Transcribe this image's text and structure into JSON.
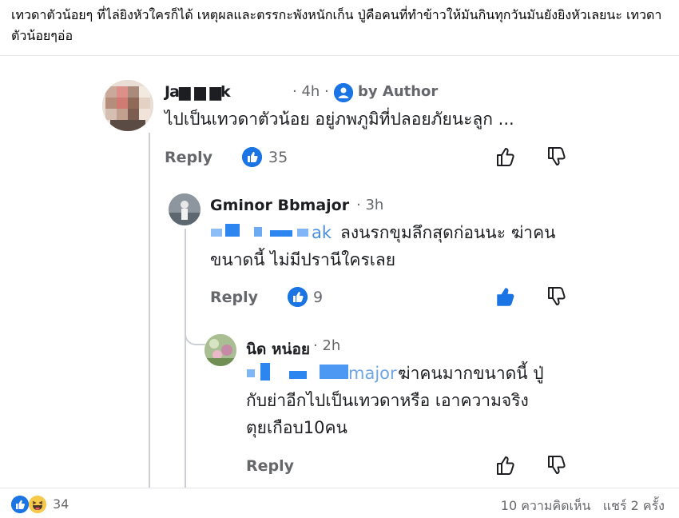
{
  "post": {
    "text": "เทวดาตัวน้อยๆ ที่ไล่ยิงหัวใครก็ได้ เหตุผลและตรรกะพังหนักเก็น  ปู่คือคนที่ทำข้าวให้มันกินทุกวันมันยังยิงหัวเลยนะ เทวดาตัวน้อยๆอ่อ"
  },
  "comments": [
    {
      "name": "Ja▆ ▆ ▆k",
      "time": "4h",
      "author_tag": "by Author",
      "text": "ไปเป็นเทวดาตัวน้อย อยู่ภพภูมิที่ปลอยภัยนะลูก ...",
      "reply_label": "Reply",
      "likes": "35"
    },
    {
      "name": "Gminor Bbmajor",
      "time": "3h",
      "mention_tail": "ak",
      "text_line1": "ลงนรกขุมลึกสุดก่อนนะ ฆ่าคน",
      "text_line2": "ขนาดนี้ ไม่มีปรานีใครเลย",
      "reply_label": "Reply",
      "likes": "9"
    },
    {
      "name": "นิด หน่อย",
      "time": "2h",
      "mention_tail": "major",
      "text_line1": " ฆ่าคนมากขนาดนี้ ปู่",
      "text_line2": "กับย่าอีกไปเป็นเทวดาหรือ เอาความจริง",
      "text_line3": "ตุยเกือบ10คน",
      "reply_label": "Reply"
    }
  ],
  "footer": {
    "reaction_count": "34",
    "comments": "10 ความคิดเห็น",
    "shares": "แชร์ 2 ครั้ง"
  },
  "colors": {
    "accent": "#1b74e4",
    "muted": "#65676b",
    "line": "#ccd0d5"
  }
}
